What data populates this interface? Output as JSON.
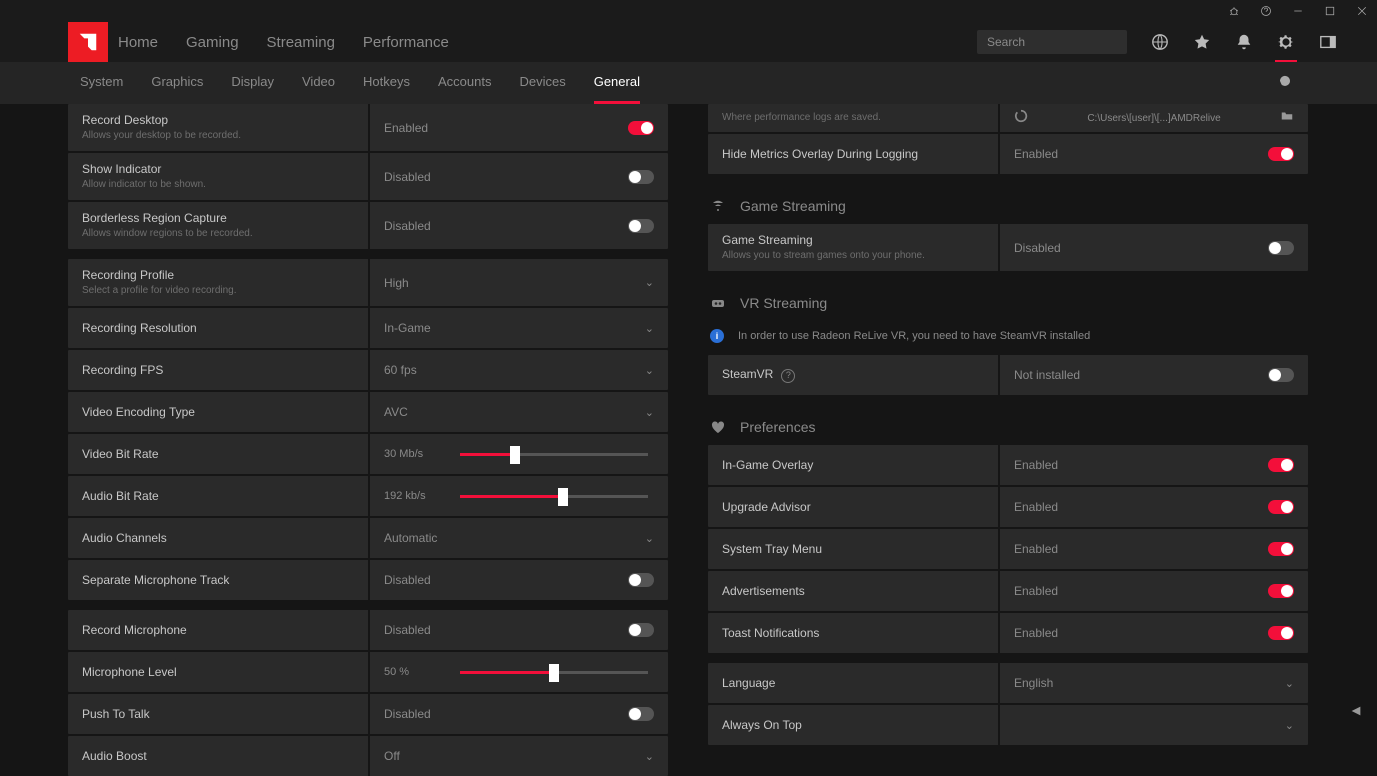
{
  "titlebar": {
    "icons": [
      "bug",
      "help",
      "minimize",
      "maximize",
      "close"
    ]
  },
  "primary_nav": [
    "Home",
    "Gaming",
    "Streaming",
    "Performance"
  ],
  "search": {
    "placeholder": "Search"
  },
  "header_icons": [
    "globe",
    "star",
    "bell",
    "settings",
    "panel"
  ],
  "active_header_icon": "settings",
  "sub_tabs": [
    "System",
    "Graphics",
    "Display",
    "Video",
    "Hotkeys",
    "Accounts",
    "Devices",
    "General"
  ],
  "active_sub_tab": "General",
  "left": {
    "rows": [
      {
        "kind": "toggle",
        "label": "Record Desktop",
        "sub": "Allows your desktop to be recorded.",
        "value": "Enabled",
        "on": true
      },
      {
        "kind": "toggle",
        "label": "Show Indicator",
        "sub": "Allow indicator to be shown.",
        "value": "Disabled",
        "on": false
      },
      {
        "kind": "toggle",
        "label": "Borderless Region Capture",
        "sub": "Allows window regions to be recorded.",
        "value": "Disabled",
        "on": false
      },
      {
        "kind": "gap"
      },
      {
        "kind": "dropdown",
        "label": "Recording Profile",
        "sub": "Select a profile for video recording.",
        "value": "High"
      },
      {
        "kind": "dropdown",
        "label": "Recording Resolution",
        "value": "In-Game"
      },
      {
        "kind": "dropdown",
        "label": "Recording FPS",
        "value": "60 fps"
      },
      {
        "kind": "dropdown",
        "label": "Video Encoding Type",
        "value": "AVC"
      },
      {
        "kind": "slider",
        "label": "Video Bit Rate",
        "value": "30 Mb/s",
        "pct": 29
      },
      {
        "kind": "slider",
        "label": "Audio Bit Rate",
        "value": "192 kb/s",
        "pct": 55
      },
      {
        "kind": "dropdown",
        "label": "Audio Channels",
        "value": "Automatic"
      },
      {
        "kind": "toggle",
        "label": "Separate Microphone Track",
        "value": "Disabled",
        "on": false
      },
      {
        "kind": "gap"
      },
      {
        "kind": "toggle",
        "label": "Record Microphone",
        "value": "Disabled",
        "on": false
      },
      {
        "kind": "slider",
        "label": "Microphone Level",
        "value": "50 %",
        "pct": 50
      },
      {
        "kind": "toggle",
        "label": "Push To Talk",
        "value": "Disabled",
        "on": false,
        "share": true
      },
      {
        "kind": "dropdown",
        "label": "Audio Boost",
        "value": "Off"
      }
    ]
  },
  "right": {
    "partial": {
      "sub": "Where performance logs are saved.",
      "value": "C:\\Users\\[user]\\[...]AMDRelive"
    },
    "logging_row": {
      "label": "Hide Metrics Overlay During Logging",
      "value": "Enabled",
      "on": true
    },
    "sections": [
      {
        "title": "Game Streaming",
        "icon": "stream",
        "rows": [
          {
            "kind": "toggle",
            "label": "Game Streaming",
            "sub": "Allows you to stream games onto your phone.",
            "value": "Disabled",
            "on": false
          }
        ]
      },
      {
        "title": "VR Streaming",
        "icon": "vr",
        "info": "In order to use Radeon ReLive VR, you need to have SteamVR installed",
        "rows": [
          {
            "kind": "toggle",
            "label": "SteamVR",
            "help": true,
            "value": "Not installed",
            "on": false
          }
        ]
      },
      {
        "title": "Preferences",
        "icon": "heart",
        "rows": [
          {
            "kind": "toggle",
            "label": "In-Game Overlay",
            "value": "Enabled",
            "on": true
          },
          {
            "kind": "toggle",
            "label": "Upgrade Advisor",
            "value": "Enabled",
            "on": true
          },
          {
            "kind": "toggle",
            "label": "System Tray Menu",
            "value": "Enabled",
            "on": true
          },
          {
            "kind": "toggle",
            "label": "Advertisements",
            "value": "Enabled",
            "on": true
          },
          {
            "kind": "toggle",
            "label": "Toast Notifications",
            "value": "Enabled",
            "on": true
          },
          {
            "kind": "gap"
          },
          {
            "kind": "dropdown",
            "label": "Language",
            "value": "English"
          },
          {
            "kind": "dropdown",
            "label": "Always On Top",
            "value": ""
          }
        ]
      }
    ]
  }
}
